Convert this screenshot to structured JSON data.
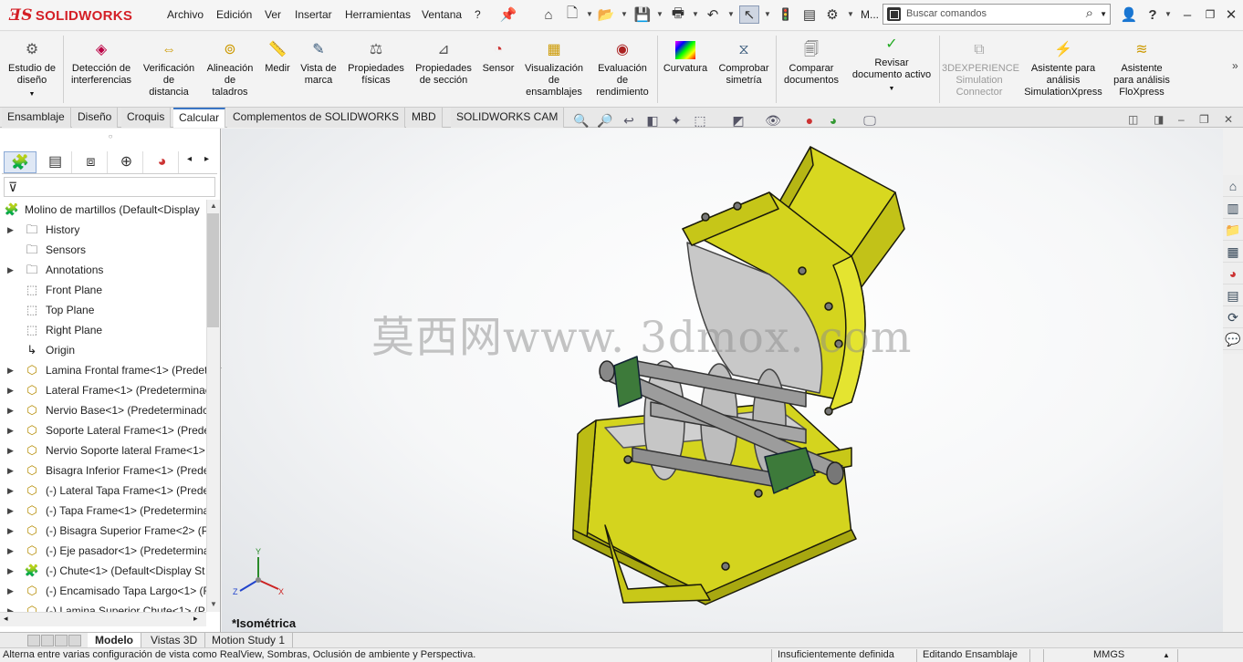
{
  "app": {
    "brand": "SOLIDWORKS",
    "brand_color": "#d41f26"
  },
  "menu": [
    "Archivo",
    "Edición",
    "Ver",
    "Insertar",
    "Herramientas",
    "Ventana",
    "?"
  ],
  "menu_overflow": "M...",
  "search": {
    "placeholder": "Buscar comandos"
  },
  "ribbon": [
    {
      "label": "Estudio de\ndiseño",
      "icon": "design-study-icon"
    },
    {
      "label": "Detección de\ninterferencias",
      "icon": "interference-icon"
    },
    {
      "label": "Verificación\nde\ndistancia",
      "icon": "clearance-icon"
    },
    {
      "label": "Alineación\nde\ntaladros",
      "icon": "hole-alignment-icon"
    },
    {
      "label": "Medir",
      "icon": "measure-icon"
    },
    {
      "label": "Vista de\nmarca",
      "icon": "markup-icon"
    },
    {
      "label": "Propiedades\nfísicas",
      "icon": "mass-properties-icon"
    },
    {
      "label": "Propiedades\nde sección",
      "icon": "section-properties-icon"
    },
    {
      "label": "Sensor",
      "icon": "sensor-icon"
    },
    {
      "label": "Visualización\nde\nensamblajes",
      "icon": "assembly-visualization-icon"
    },
    {
      "label": "Evaluación\nde\nrendimiento",
      "icon": "performance-icon"
    },
    {
      "label": "Curvatura",
      "icon": "curvature-icon"
    },
    {
      "label": "Comprobar\nsimetría",
      "icon": "symmetry-icon"
    },
    {
      "label": "Comparar\ndocumentos",
      "icon": "compare-icon"
    },
    {
      "label": "Revisar\ndocumento activo",
      "icon": "check-active-icon"
    },
    {
      "label": "3DEXPERIENCE\nSimulation\nConnector",
      "icon": "connector-icon",
      "disabled": true
    },
    {
      "label": "Asistente para\nanálisis\nSimulationXpress",
      "icon": "simxpress-icon"
    },
    {
      "label": "Asistente\npara análisis\nFloXpress",
      "icon": "floxpress-icon"
    }
  ],
  "command_tabs": [
    {
      "label": "Ensamblaje"
    },
    {
      "label": "Diseño"
    },
    {
      "label": "Croquis"
    },
    {
      "label": "Calcular",
      "active": true
    },
    {
      "label": "Complementos de SOLIDWORKS"
    },
    {
      "label": "MBD"
    },
    {
      "label": "SOLIDWORKS CAM"
    }
  ],
  "tree": {
    "root": "Molino de martillos  (Default<Display",
    "items": [
      {
        "label": "History",
        "icon": "history-icon",
        "arrow": true,
        "kind": "folder"
      },
      {
        "label": "Sensors",
        "icon": "sensors-icon",
        "arrow": false,
        "kind": "folder"
      },
      {
        "label": "Annotations",
        "icon": "annotations-icon",
        "arrow": true,
        "kind": "folder"
      },
      {
        "label": "Front Plane",
        "icon": "plane-icon",
        "arrow": false,
        "kind": "plane"
      },
      {
        "label": "Top Plane",
        "icon": "plane-icon",
        "arrow": false,
        "kind": "plane"
      },
      {
        "label": "Right Plane",
        "icon": "plane-icon",
        "arrow": false,
        "kind": "plane"
      },
      {
        "label": "Origin",
        "icon": "origin-icon",
        "arrow": false,
        "kind": "origin"
      },
      {
        "label": "Lamina Frontal frame<1> (Predet",
        "icon": "part-icon",
        "arrow": true,
        "kind": "part"
      },
      {
        "label": "Lateral Frame<1> (Predeterminac",
        "icon": "part-icon",
        "arrow": true,
        "kind": "part"
      },
      {
        "label": "Nervio Base<1> (Predeterminadc",
        "icon": "part-icon",
        "arrow": true,
        "kind": "part"
      },
      {
        "label": "Soporte Lateral Frame<1> (Prede",
        "icon": "part-icon",
        "arrow": true,
        "kind": "part"
      },
      {
        "label": "Nervio Soporte lateral Frame<1>",
        "icon": "part-icon",
        "arrow": true,
        "kind": "part"
      },
      {
        "label": "Bisagra Inferior Frame<1> (Prede",
        "icon": "part-icon",
        "arrow": true,
        "kind": "part"
      },
      {
        "label": "(-) Lateral Tapa Frame<1> (Prede",
        "icon": "part-icon",
        "arrow": true,
        "kind": "part"
      },
      {
        "label": "(-) Tapa Frame<1> (Predetermina",
        "icon": "part-icon",
        "arrow": true,
        "kind": "part"
      },
      {
        "label": "(-) Bisagra Superior Frame<2> (P",
        "icon": "part-icon",
        "arrow": true,
        "kind": "part"
      },
      {
        "label": "(-) Eje pasador<1> (Predetermina",
        "icon": "part-icon",
        "arrow": true,
        "kind": "part"
      },
      {
        "label": "(-) Chute<1> (Default<Display St",
        "icon": "assembly-icon",
        "arrow": true,
        "kind": "assembly"
      },
      {
        "label": "(-) Encamisado Tapa Largo<1> (F",
        "icon": "part-icon",
        "arrow": true,
        "kind": "part"
      },
      {
        "label": "(-) Lamina Superior Chute<1> (P",
        "icon": "part-icon",
        "arrow": true,
        "kind": "part"
      }
    ]
  },
  "viewport": {
    "watermark": "莫西网www. 3dmox. com",
    "view_label": "*Isométrica",
    "model_color": "#d4d41e"
  },
  "bottom_tabs": [
    {
      "label": "Modelo",
      "active": true
    },
    {
      "label": "Vistas 3D"
    },
    {
      "label": "Motion Study 1"
    }
  ],
  "status": {
    "message": "Alterna entre varias configuración de vista como RealView, Sombras, Oclusión de ambiente y Perspectiva.",
    "definition": "Insuficientemente definida",
    "mode": "Editando Ensamblaje",
    "units": "MMGS"
  }
}
